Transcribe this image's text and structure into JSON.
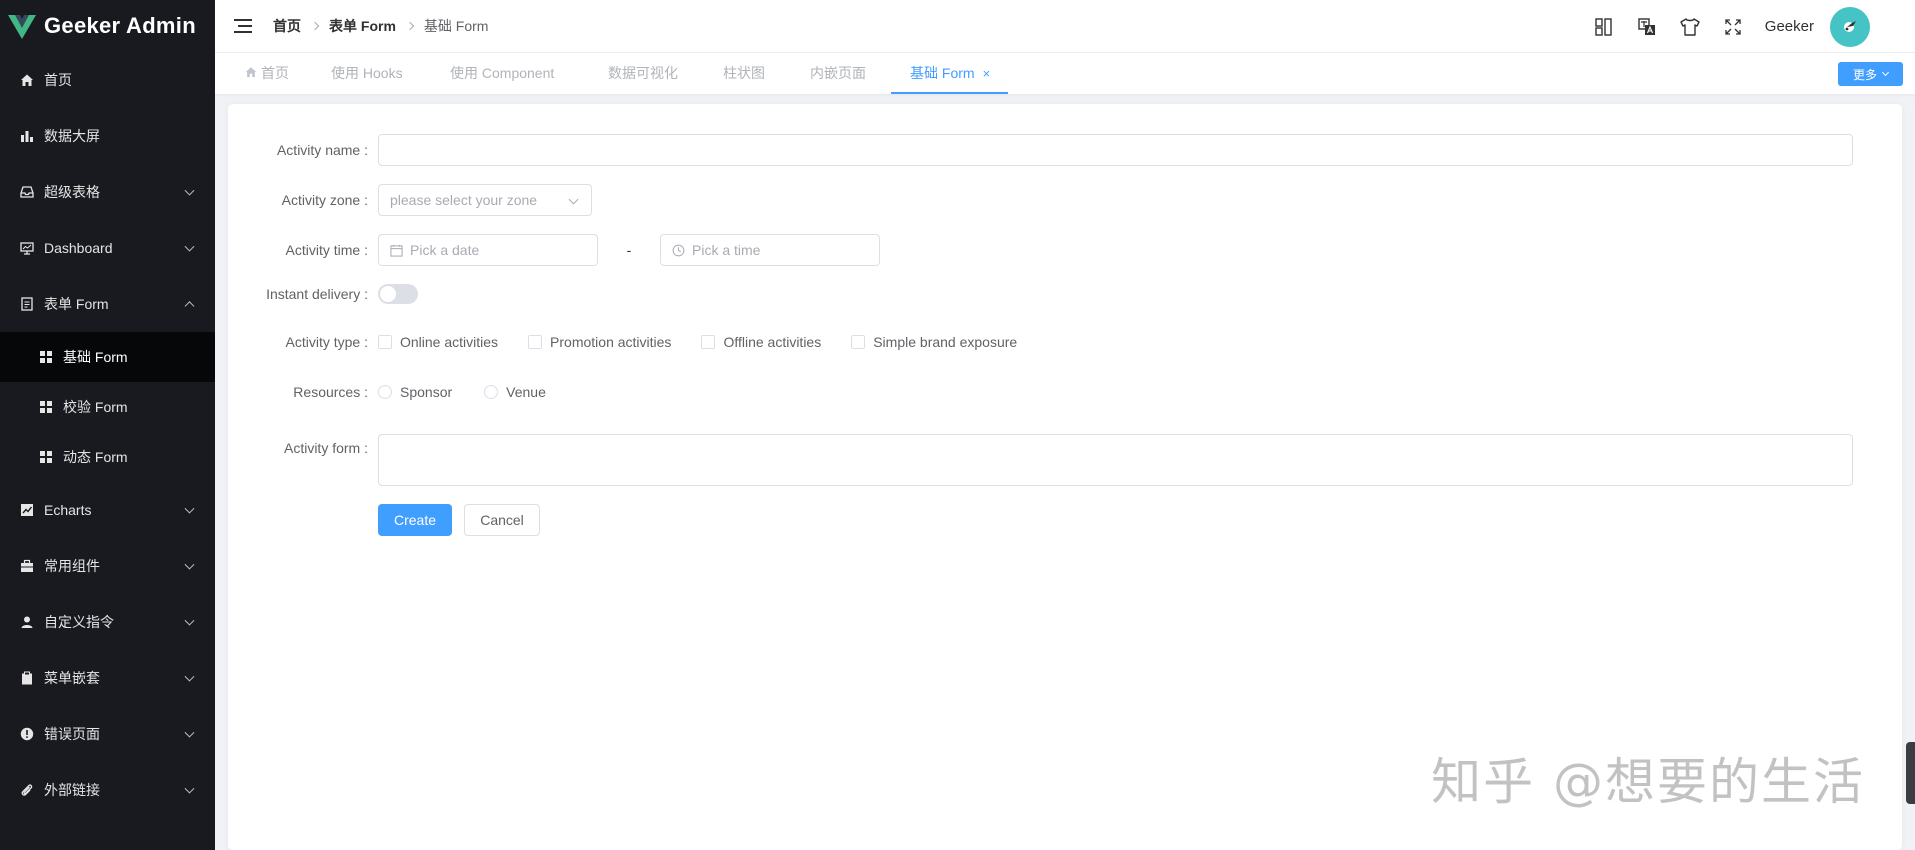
{
  "app": {
    "title": "Geeker Admin"
  },
  "sidebar": {
    "items": [
      {
        "label": "首页",
        "icon": "home-icon"
      },
      {
        "label": "数据大屏",
        "icon": "bar-chart-icon"
      },
      {
        "label": "超级表格",
        "icon": "inbox-icon"
      },
      {
        "label": "Dashboard",
        "icon": "monitor-icon"
      },
      {
        "label": "表单 Form",
        "icon": "document-icon"
      },
      {
        "label": "Echarts",
        "icon": "trend-chart-icon"
      },
      {
        "label": "常用组件",
        "icon": "briefcase-icon"
      },
      {
        "label": "自定义指令",
        "icon": "user-icon"
      },
      {
        "label": "菜单嵌套",
        "icon": "clipboard-icon"
      },
      {
        "label": "错误页面",
        "icon": "warning-icon"
      },
      {
        "label": "外部链接",
        "icon": "paperclip-icon"
      }
    ],
    "sub_items": [
      {
        "label": "基础 Form",
        "active": true
      },
      {
        "label": "校验 Form",
        "active": false
      },
      {
        "label": "动态 Form",
        "active": false
      }
    ]
  },
  "header": {
    "breadcrumb": [
      "首页",
      "表单 Form",
      "基础 Form"
    ],
    "username": "Geeker"
  },
  "tabs": {
    "items": [
      {
        "label": "首页",
        "icon": "home-icon"
      },
      {
        "label": "使用 Hooks"
      },
      {
        "label": "使用 Component"
      },
      {
        "label": "数据可视化"
      },
      {
        "label": "柱状图"
      },
      {
        "label": "内嵌页面"
      },
      {
        "label": "基础 Form",
        "active": true,
        "close": "×"
      }
    ],
    "more_label": "更多"
  },
  "form": {
    "activity_name": {
      "label": "Activity name :",
      "value": ""
    },
    "activity_zone": {
      "label": "Activity zone :",
      "placeholder": "please select your zone"
    },
    "activity_time": {
      "label": "Activity time :",
      "date_placeholder": "Pick a date",
      "separator": "-",
      "time_placeholder": "Pick a time"
    },
    "instant_delivery": {
      "label": "Instant delivery :",
      "on": false
    },
    "activity_type": {
      "label": "Activity type :",
      "options": [
        "Online activities",
        "Promotion activities",
        "Offline activities",
        "Simple brand exposure"
      ]
    },
    "resources": {
      "label": "Resources :",
      "options": [
        "Sponsor",
        "Venue"
      ]
    },
    "activity_form": {
      "label": "Activity form :",
      "value": ""
    },
    "create_label": "Create",
    "cancel_label": "Cancel"
  },
  "watermark": "知乎 @想要的生活",
  "colors": {
    "primary": "#409eff",
    "sidebar_bg": "#191a20",
    "avatar_bg": "#45c3c5"
  }
}
